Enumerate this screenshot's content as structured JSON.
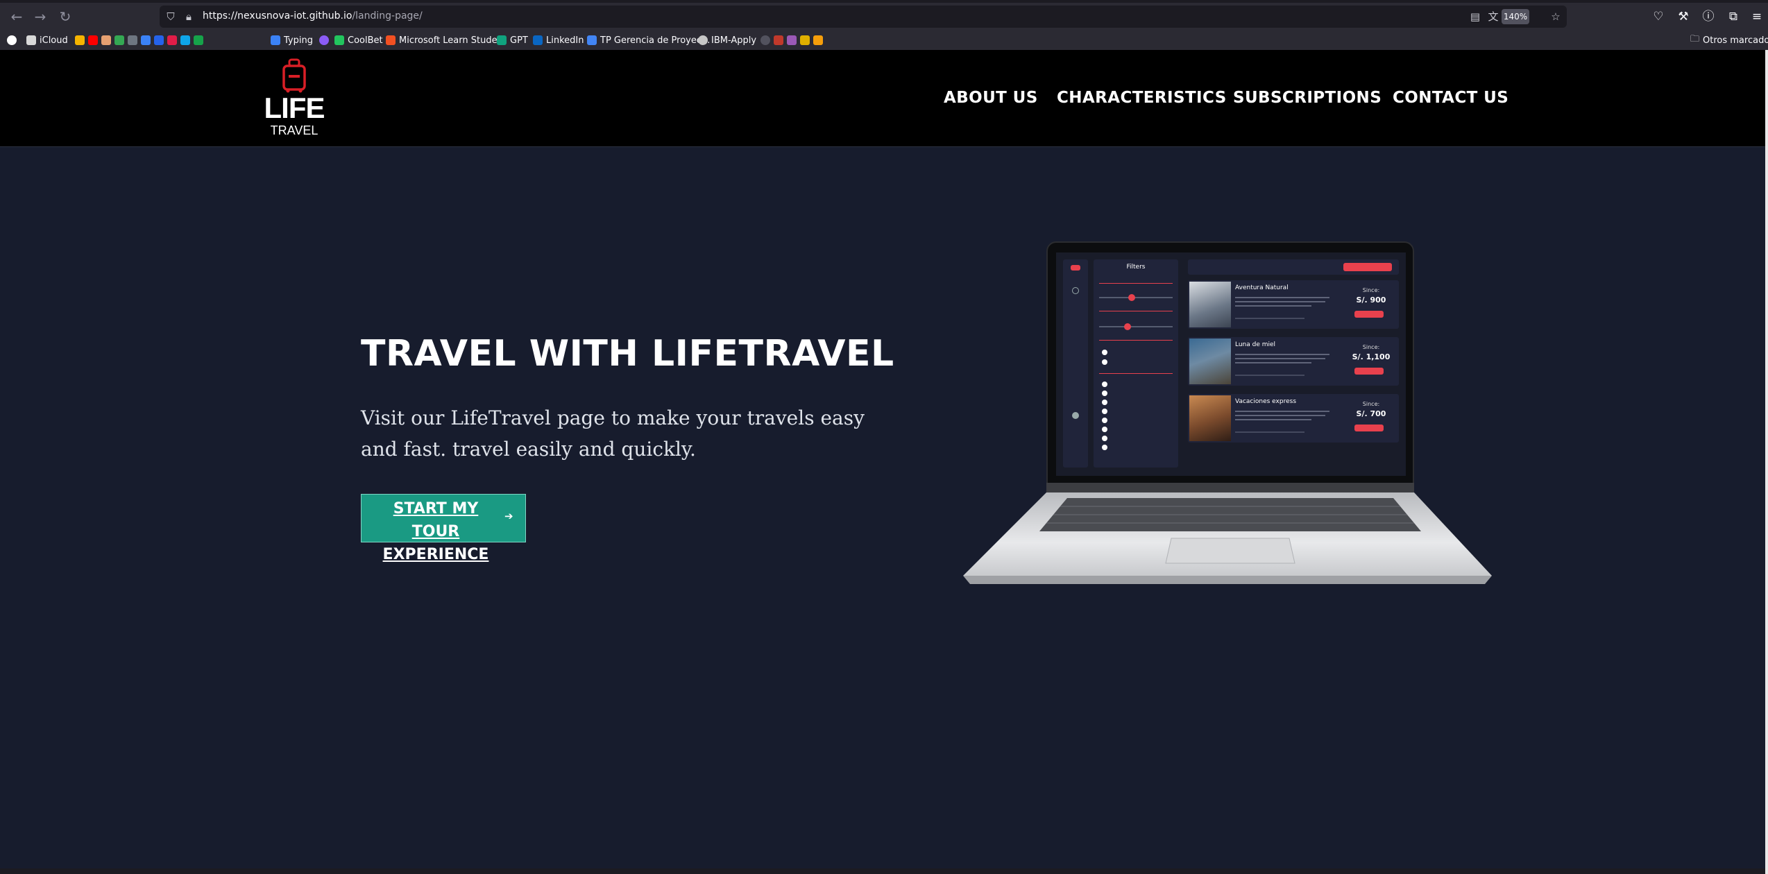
{
  "browser": {
    "url_host": "https://nexusnova-iot.github.io",
    "url_path": "/landing-page/",
    "zoom": "140%",
    "bookmarks": [
      {
        "label": "iCloud",
        "color": "#d8d8d8"
      },
      {
        "label": "Typing",
        "color": "#3b82f6"
      },
      {
        "label": "CoolBet",
        "color": "#22c55e"
      },
      {
        "label": "Microsoft Learn Stude...",
        "color": "#f25022"
      },
      {
        "label": "GPT",
        "color": "#10a37f"
      },
      {
        "label": "LinkedIn",
        "color": "#0a66c2"
      },
      {
        "label": "TP Gerencia de Proyec...",
        "color": "#4285f4"
      },
      {
        "label": "IBM-Apply",
        "color": "#c6c6c6"
      }
    ],
    "other_bookmarks": "Otros marcadores"
  },
  "site": {
    "logo_main": "LIFE",
    "logo_sub": "TRAVEL",
    "nav": [
      "ABOUT US",
      "CHARACTERISTICS",
      "SUBSCRIPTIONS",
      "CONTACT US"
    ]
  },
  "hero": {
    "title": "TRAVEL WITH LIFETRAVEL",
    "subtitle": "Visit our LifeTravel page to make your travels easy and fast. travel easily and quickly.",
    "cta": "START MY TOUR EXPERIENCE"
  },
  "mockup": {
    "filters_title": "Filters",
    "cards": [
      {
        "title": "Aventura Natural",
        "since": "Since:",
        "price": "S/. 900"
      },
      {
        "title": "Luna de miel",
        "since": "Since:",
        "price": "S/. 1,100"
      },
      {
        "title": "Vacaciones express",
        "since": "Since:",
        "price": "S/. 700"
      }
    ]
  }
}
